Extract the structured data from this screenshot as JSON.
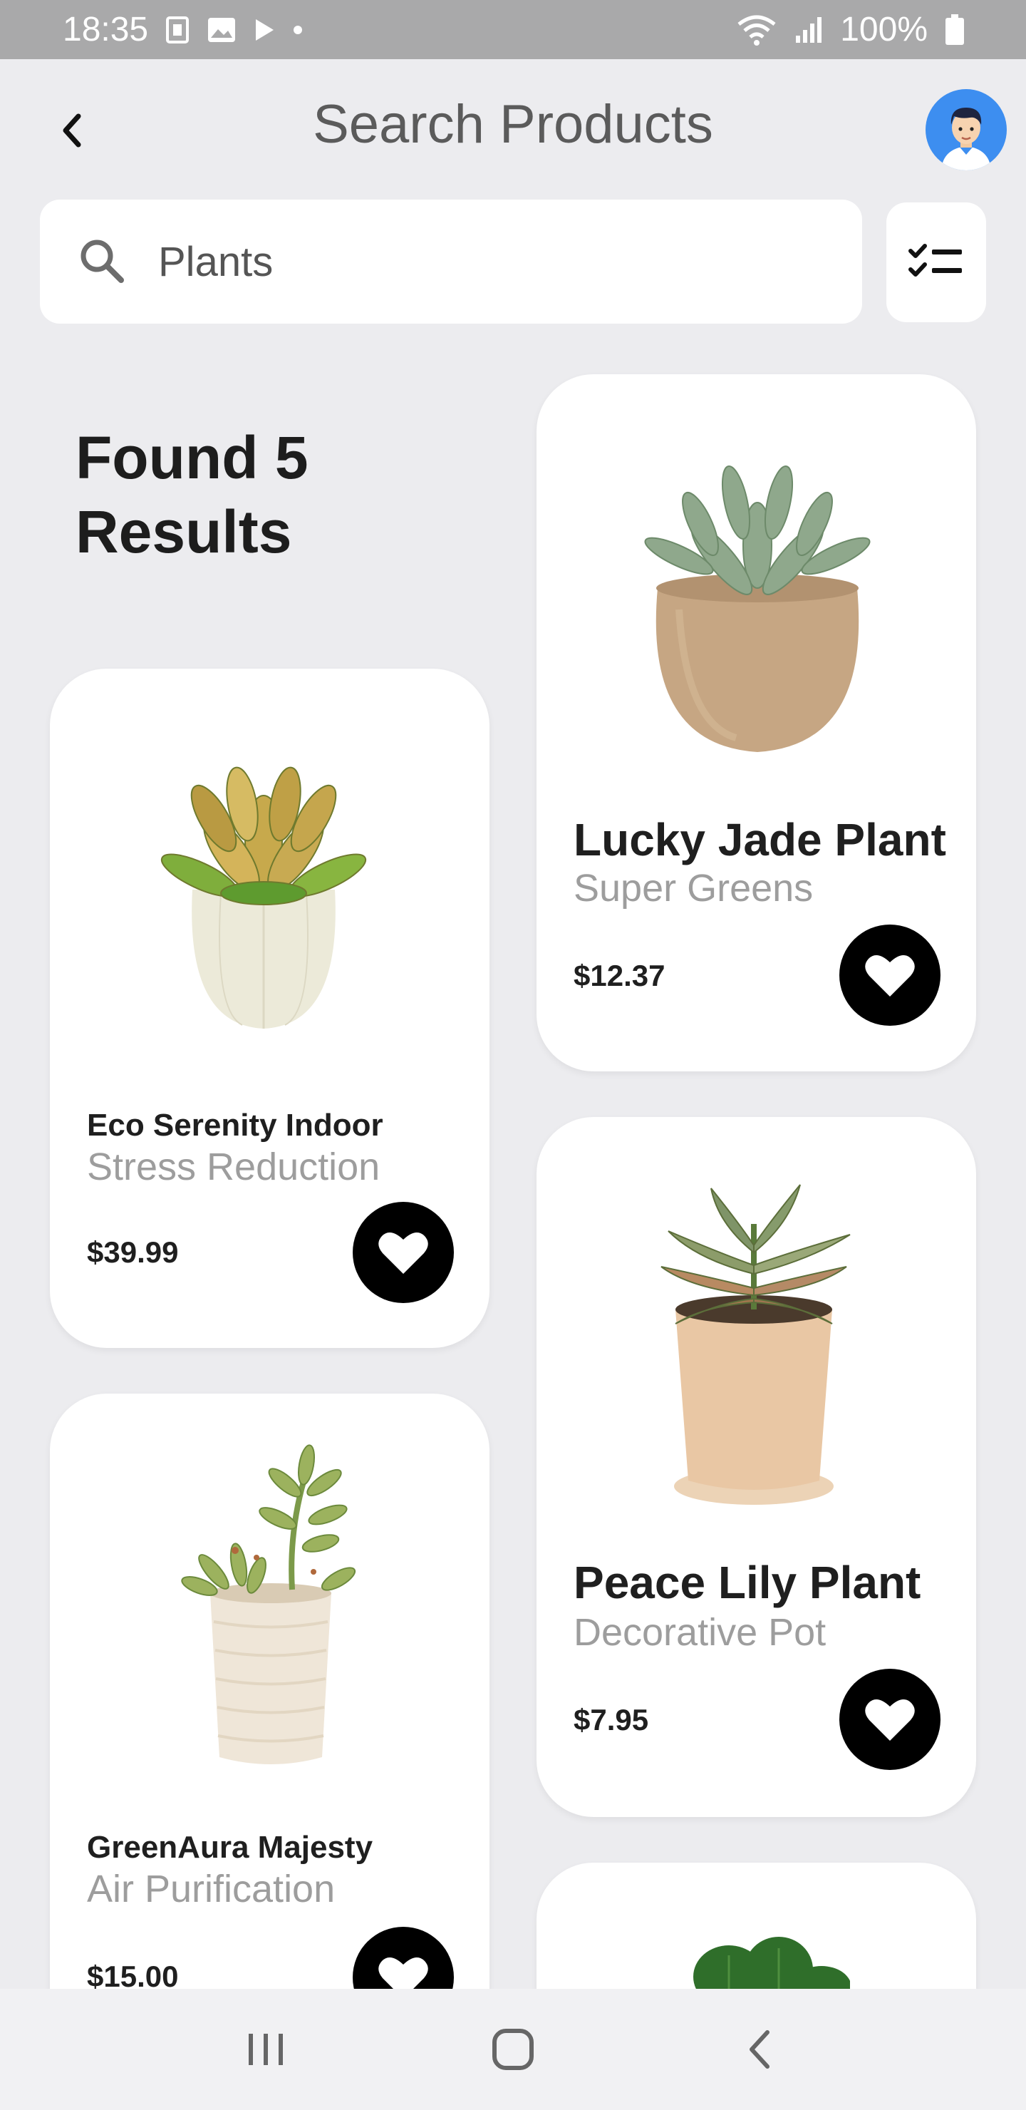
{
  "status_bar": {
    "time": "18:35",
    "battery": "100%"
  },
  "header": {
    "title": "Search Products"
  },
  "search": {
    "value": "Plants",
    "placeholder": "Search"
  },
  "results": {
    "heading_line1": "Found 5",
    "heading_line2": "Results"
  },
  "products": [
    {
      "name": "Lucky Jade Plant",
      "subtitle": "Super Greens",
      "price": "$12.37"
    },
    {
      "name": "Eco Serenity Indoor",
      "subtitle": "Stress Reduction",
      "price": "$39.99"
    },
    {
      "name": "Peace Lily Plant",
      "subtitle": "Decorative Pot",
      "price": "$7.95"
    },
    {
      "name": "GreenAura Majesty",
      "subtitle": "Air Purification",
      "price": "$15.00"
    }
  ],
  "colors": {
    "background": "#ececef",
    "status_bar": "#a9a9aa",
    "avatar": "#3d8ef0",
    "favorite_button": "#000000"
  },
  "icons": {
    "back": "chevron-left-icon",
    "search": "search-icon",
    "filter": "checklist-filter-icon",
    "favorite": "heart-icon",
    "nav_recents": "recents-icon",
    "nav_home": "home-icon",
    "nav_back": "back-icon"
  }
}
